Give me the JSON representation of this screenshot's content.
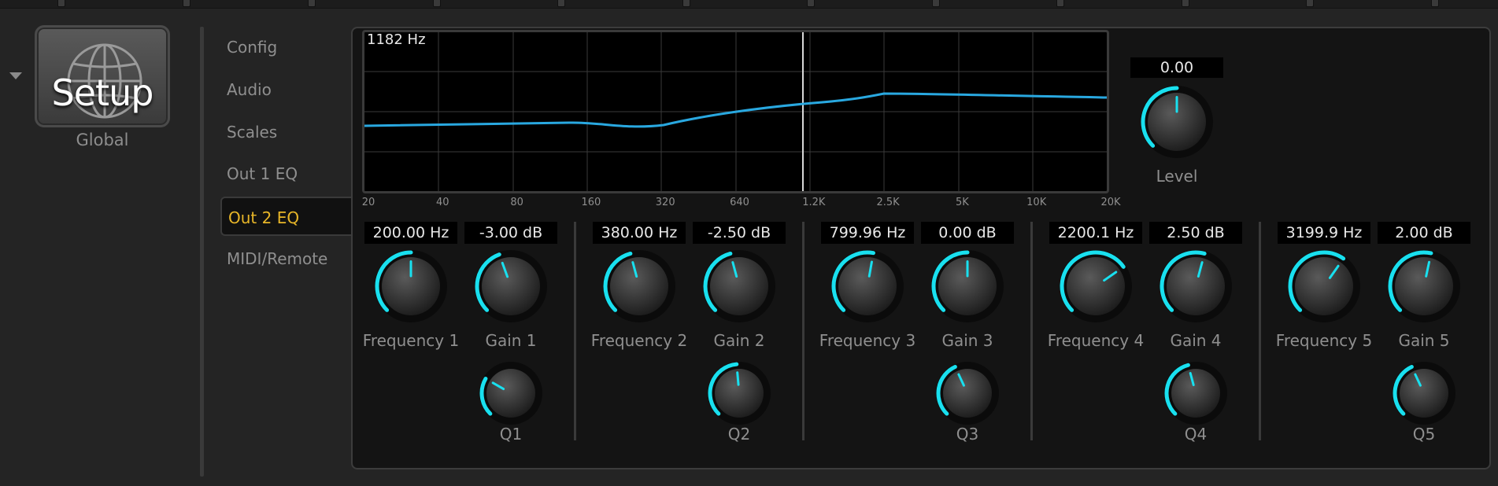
{
  "header": {
    "title": "Setup",
    "subtitle": "Global"
  },
  "nav": {
    "items": [
      {
        "label": "Config",
        "active": false
      },
      {
        "label": "Audio",
        "active": false
      },
      {
        "label": "Scales",
        "active": false
      },
      {
        "label": "Out 1 EQ",
        "active": false
      },
      {
        "label": "Out 2 EQ",
        "active": true
      },
      {
        "label": "MIDI/Remote",
        "active": false
      }
    ]
  },
  "graph": {
    "cursor_readout": "1182 Hz",
    "x_ticks": [
      "20",
      "40",
      "80",
      "160",
      "320",
      "640",
      "1.2K",
      "2.5K",
      "5K",
      "10K",
      "20K"
    ],
    "curve_color": "#29a8e0",
    "cursor_color": "#d8d8d8"
  },
  "level": {
    "value": "0.00",
    "label": "Level"
  },
  "bands": [
    {
      "freq_value": "200.00 Hz",
      "freq_label": "Frequency 1",
      "gain_value": "-3.00 dB",
      "gain_label": "Gain 1",
      "q_label": "Q1"
    },
    {
      "freq_value": "380.00 Hz",
      "freq_label": "Frequency 2",
      "gain_value": "-2.50 dB",
      "gain_label": "Gain 2",
      "q_label": "Q2"
    },
    {
      "freq_value": "799.96 Hz",
      "freq_label": "Frequency 3",
      "gain_value": "0.00 dB",
      "gain_label": "Gain 3",
      "q_label": "Q3"
    },
    {
      "freq_value": "2200.1 Hz",
      "freq_label": "Frequency 4",
      "gain_value": "2.50 dB",
      "gain_label": "Gain 4",
      "q_label": "Q4"
    },
    {
      "freq_value": "3199.9 Hz",
      "freq_label": "Frequency 5",
      "gain_value": "2.00 dB",
      "gain_label": "Gain 5",
      "q_label": "Q5"
    }
  ],
  "colors": {
    "accent": "#19e0ef",
    "active_nav": "#e8b628",
    "panel_bg": "#141414"
  },
  "icons": {
    "setup": "globe-icon",
    "dropdown": "triangle-down-icon"
  }
}
